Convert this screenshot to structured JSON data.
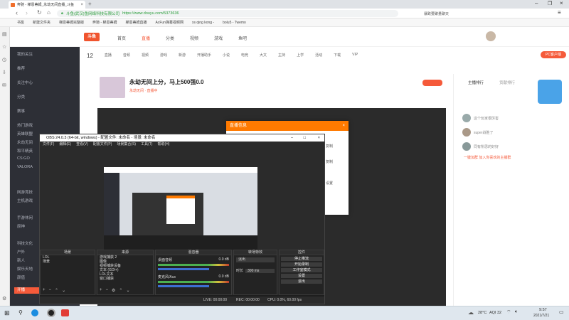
{
  "browser": {
    "tab_title": "奔驰 - 梯恩蒂姆_永劫无间直播_斗鱼",
    "url_secure": "斗鱼(武汉)鱼网络科技有限公司",
    "url": "https://www.douyu.com/5373636",
    "search_hint": "暴跌要聚量聊天",
    "bookmarks": [
      "书签",
      "新建文件夹",
      "梯恩蒂姆完整版",
      "奔驰 - 梯恩蒂姆",
      "梯恩蒂姆直播",
      "AcFun弹幕视频网",
      "xs qing kong -",
      "bolu5 - Twemo"
    ]
  },
  "douyu": {
    "logo": "斗鱼",
    "nav": [
      "首页",
      "直播",
      "分类",
      "视频",
      "游戏",
      "鱼吧"
    ],
    "sidebar": [
      "我的关注",
      "推荐",
      "关注中心",
      "分类",
      "赛事",
      "热门游戏",
      "英雄联盟",
      "永劫无间",
      "和平精英",
      "CS:GO",
      "VALORA",
      "网游竞技",
      "主机游戏",
      "手游休闲",
      "原神",
      "科技文化",
      "户外",
      "新人",
      "娱乐天地",
      "颜值",
      "开播"
    ],
    "categories": [
      "12",
      "直播",
      "音频",
      "视频",
      "游戏",
      "新游",
      "开播助手",
      "小说",
      "电竞",
      "大文",
      "主持",
      "上学",
      "活动",
      "下载",
      "VIP",
      "PC客户端"
    ],
    "room_title": "永劫无间上分，马上500强0.0",
    "room_meta": "永劫无间 · 直播中",
    "chat_header": "主播排行",
    "chat_tab2": "贡献排行",
    "chat_items": [
      "这个玩家很厉害",
      "super战胜了",
      "同有所思的好好"
    ],
    "chat_link": "一键加群 加入你喜欢的主播群",
    "dialog_title": "直播信息",
    "dialog_items": [
      "复制",
      "复制"
    ],
    "dialog_link": "设置"
  },
  "obs": {
    "title": "OBS 24.0.3 (64-bit, windows) - 配置文件: 未命名 - 场景: 未命名",
    "menu": [
      "文件(F)",
      "编辑(E)",
      "查看(V)",
      "配置文件(P)",
      "场景集合(S)",
      "工具(T)",
      "帮助(H)"
    ],
    "docks": [
      "场景",
      "来源",
      "混音器",
      "转场特效",
      "控件"
    ],
    "scenes": [
      "LOL",
      "场景"
    ],
    "sources": [
      "游戏捕获 2",
      "图像",
      "视频捕获设备",
      "文本 (GDI+)",
      "LOL文本",
      "窗口捕获"
    ],
    "mixer": [
      {
        "name": "桌面音频",
        "db": "0.0 dB"
      },
      {
        "name": "麦克风/Aux",
        "db": "0.0 dB"
      }
    ],
    "transition": {
      "type": "淡出",
      "duration_label": "时长",
      "duration": "300 ms"
    },
    "controls": [
      "停止推流",
      "开始录制",
      "工作室模式",
      "设置",
      "退出"
    ],
    "status": {
      "live": "LIVE: 00:00:00",
      "rec": "REC: 00:00:00",
      "cpu": "CPU: 0.0%, 60.00 fps"
    }
  },
  "taskbar": {
    "weather": "28°C",
    "aqi": "AQI 32",
    "time": "9:57",
    "date": "2021/7/21"
  },
  "colors": {
    "douyu_accent": "#f55a3a",
    "dialog_header": "#ff7a00",
    "obs_bg": "#2b2b2b"
  }
}
